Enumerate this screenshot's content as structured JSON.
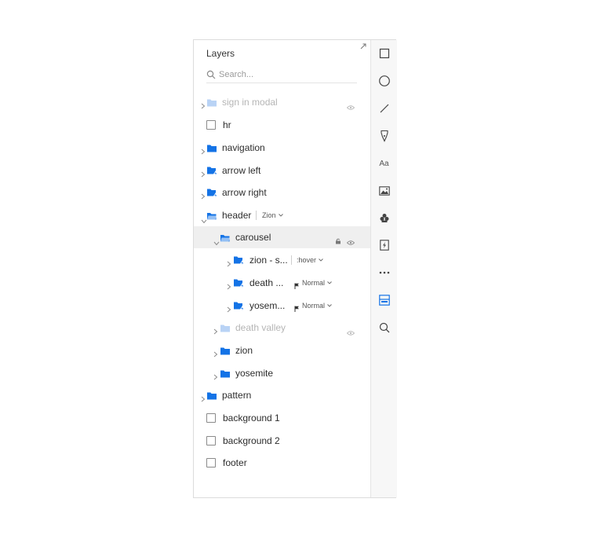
{
  "panel": {
    "title": "Layers",
    "search": {
      "placeholder": "Search..."
    }
  },
  "layers": [
    {
      "label": "sign in modal",
      "type": "folder",
      "dimmed": true,
      "hidden": true
    },
    {
      "label": "hr",
      "type": "shape"
    },
    {
      "label": "navigation",
      "type": "folder"
    },
    {
      "label": "arrow left",
      "type": "symbol"
    },
    {
      "label": "arrow right",
      "type": "symbol"
    },
    {
      "label": "header",
      "type": "folder-open",
      "expanded": true,
      "state": "Zion"
    },
    {
      "label": "carousel",
      "type": "folder-open",
      "expanded": true,
      "selected": true,
      "locked": true,
      "visible": true
    },
    {
      "label": "zion - s...",
      "type": "symbol",
      "state": ":hover"
    },
    {
      "label": "death ...",
      "type": "symbol",
      "state": "Normal",
      "flagged": true
    },
    {
      "label": "yosem...",
      "type": "symbol",
      "state": "Normal",
      "flagged": true
    },
    {
      "label": "death valley",
      "type": "folder",
      "dimmed": true,
      "hidden": true
    },
    {
      "label": "zion",
      "type": "folder"
    },
    {
      "label": "yosemite",
      "type": "folder"
    },
    {
      "label": "pattern",
      "type": "folder"
    },
    {
      "label": "background 1",
      "type": "shape"
    },
    {
      "label": "background 2",
      "type": "shape"
    },
    {
      "label": "footer",
      "type": "shape"
    }
  ],
  "toolbar": {
    "tools": [
      "rectangle-icon",
      "ellipse-icon",
      "line-icon",
      "pen-icon",
      "text-icon",
      "image-icon",
      "component-icon",
      "link-icon",
      "more-icon",
      "layers-icon",
      "zoom-icon"
    ],
    "text_tool_label": "Aa",
    "active_tool": "layers-icon"
  },
  "colors": {
    "accent": "#1473e6",
    "accent_dim": "#b9d3f5",
    "selection": "#efefef"
  }
}
